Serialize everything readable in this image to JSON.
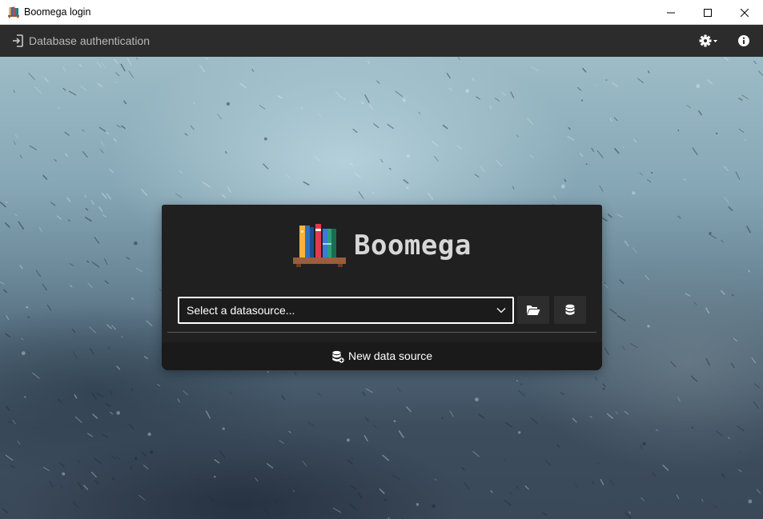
{
  "window": {
    "title": "Boomega login",
    "icon": "bookshelf-icon",
    "controls": [
      "minimize-icon",
      "maximize-icon",
      "close-icon"
    ]
  },
  "appbar": {
    "icon": "login-icon",
    "title": "Database authentication",
    "settings_icon": "gear-icon",
    "info_icon": "info-icon"
  },
  "login": {
    "app_name": "Boomega",
    "logo_icon": "bookshelf-icon",
    "datasource_placeholder": "Select a datasource...",
    "open_button_icon": "folder-open-icon",
    "database_button_icon": "database-icon",
    "new_datasource_label": "New data source",
    "new_datasource_icon": "database-add-icon"
  },
  "colors": {
    "appbar": "#2c2c2c",
    "card": "#202020",
    "text": "#ffffff",
    "muted_text": "#b9b9b9"
  }
}
